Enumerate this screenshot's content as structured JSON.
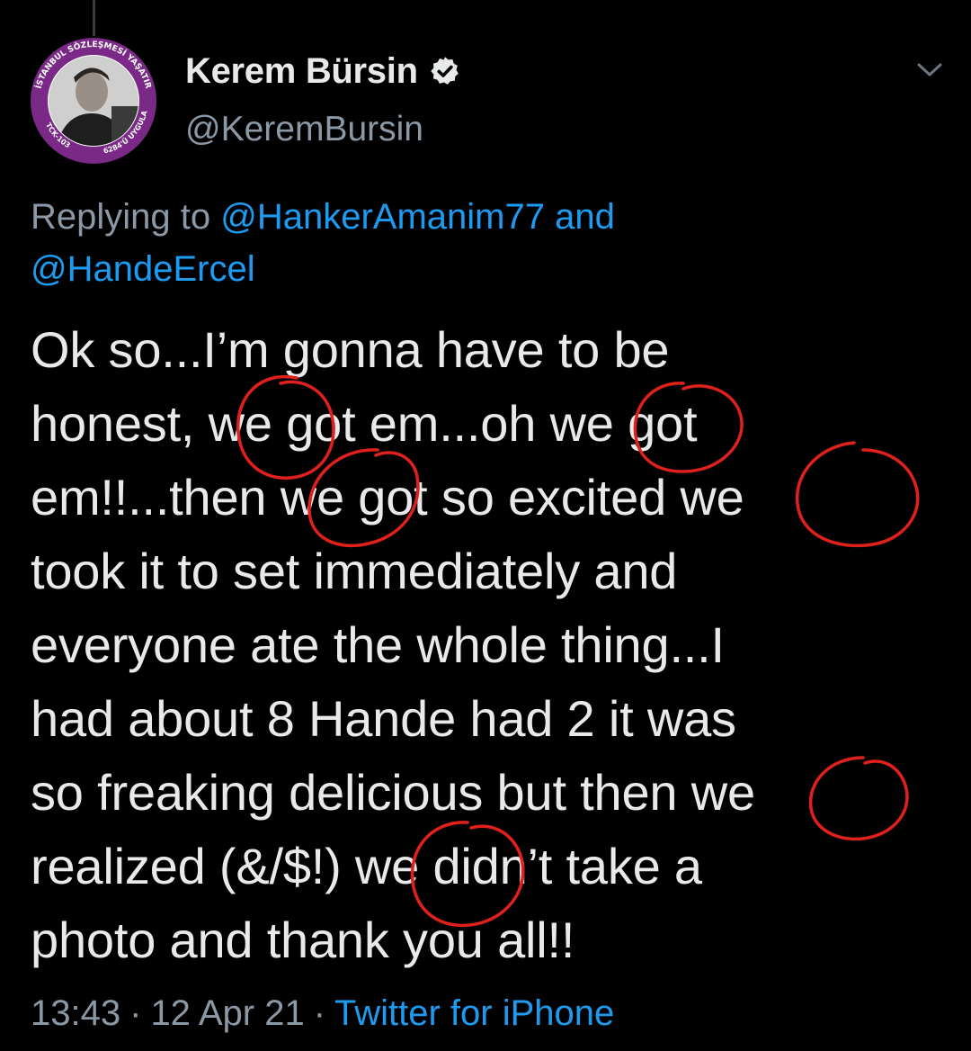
{
  "author": {
    "name": "Kerem Bürsin",
    "handle": "@KeremBursin",
    "verified": true,
    "avatar_badge": {
      "top_text": "İSTANBUL SÖZLEŞMESİ YAŞATIR",
      "left_text": "TCK-103",
      "right_text": "6284'Ü UYGULA",
      "ring_color": "#7a2a86"
    }
  },
  "reply": {
    "prefix": "Replying to",
    "mention_1": "@HankerAmanim77",
    "conjunction": "and",
    "mention_2": "@HandeErcel"
  },
  "tweet": {
    "lines": [
      "Ok so...I’m gonna have to be",
      "honest, we got em...oh we got",
      "em!!...then we got so excited we",
      "took it to set immediately and",
      "everyone ate the whole thing...I",
      "had about 8 Hande had 2 it was",
      "so freaking delicious but then we",
      "realized (&/$!) we didn’t take a",
      "photo and thank you all!!"
    ]
  },
  "meta": {
    "time": "13:43",
    "date": "12 Apr 21",
    "separator": "·",
    "source": "Twitter for iPhone"
  },
  "colors": {
    "background": "#000000",
    "text": "#e7e9ea",
    "muted": "#8b98a5",
    "link": "#1d9bf0",
    "annotation_circle": "#e0201c"
  },
  "icons": {
    "verified": "verified-badge-icon",
    "menu": "chevron-down-icon"
  }
}
